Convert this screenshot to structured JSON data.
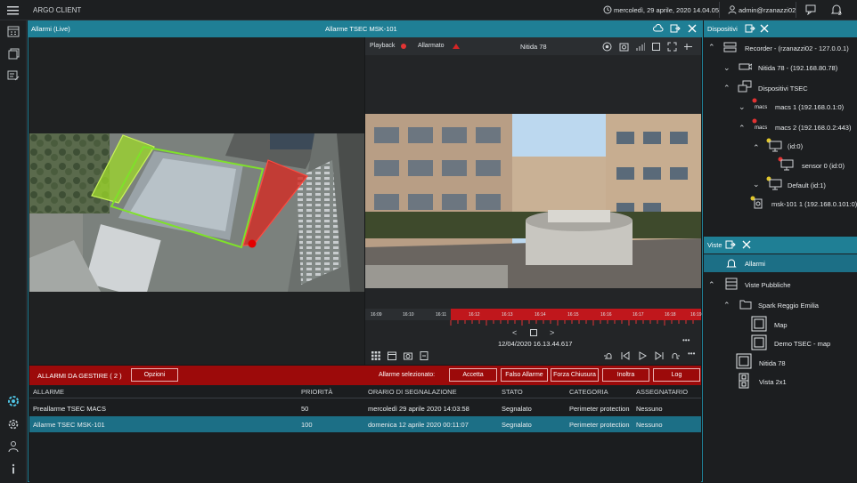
{
  "app": {
    "title": "ARGO CLIENT",
    "datetime": "mercoledì, 29 aprile, 2020 14.04.05",
    "user": "admin@rzanazzi02"
  },
  "alarm_window": {
    "left_title": "Allarmi (Live)",
    "center_title": "Allarme TSEC MSK-101"
  },
  "video": {
    "playback_label": "Playback",
    "allarmato_label": "Allarmato",
    "camera_name": "Nitida 78",
    "timestamp": "12/04/2020 16.13.44.617",
    "ticks": [
      "16:09",
      "16:10",
      "16:11",
      "16:12",
      "16:13",
      "16:14",
      "16:15",
      "16:16",
      "16:17",
      "16:18",
      "16:19"
    ]
  },
  "alarms_bar": {
    "title": "ALLARMI DA GESTIRE ( 2 )",
    "options": "Opzioni",
    "selected_label": "Allarme selezionato:",
    "accetta": "Accetta",
    "falso": "Falso Allarme",
    "forza": "Forza Chiusura",
    "inoltra": "Inoltra",
    "log": "Log"
  },
  "table": {
    "headers": [
      "ALLARME",
      "PRIORITÀ",
      "ORARIO DI SEGNALAZIONE",
      "STATO",
      "CATEGORIA",
      "ASSEGNATARIO"
    ],
    "rows": [
      [
        "Preallarme TSEC MACS",
        "50",
        "mercoledì 29 aprile 2020 14:03:58",
        "Segnalato",
        "Perimeter protection",
        "Nessuno"
      ],
      [
        "Allarme TSEC MSK-101",
        "100",
        "domenica 12 aprile 2020 00:11:07",
        "Segnalato",
        "Perimeter protection",
        "Nessuno"
      ]
    ]
  },
  "devices": {
    "title": "Dispositivi",
    "items": [
      "Recorder - (rzanazzi02 - 127.0.0.1)",
      "Nitida 78 - (192.168.80.78)",
      "Dispositivi TSEC",
      "macs 1 (192.168.0.1:0)",
      "macs 2 (192.168.0.2:443)",
      "(id:0)",
      "sensor 0 (id:0)",
      "Default (id:1)",
      "msk-101 1 (192.168.0.101:0)"
    ]
  },
  "views": {
    "title": "Viste",
    "items": [
      "Allarmi",
      "Viste Pubbliche",
      "Spark Reggio Emilia",
      "Map",
      "Demo TSEC - map",
      "Nitida 78",
      "Vista 2x1"
    ]
  },
  "colors": {
    "accent": "#1f7f95",
    "alarm_red": "#9c0a0a",
    "selected_row": "#1c6f86"
  }
}
